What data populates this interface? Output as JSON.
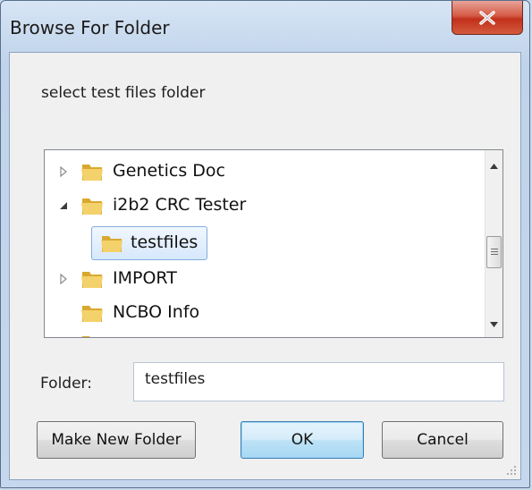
{
  "window": {
    "title": "Browse For Folder",
    "close_icon": "close-icon",
    "accent_close": "#c73b25"
  },
  "prompt": "select test files folder",
  "tree": {
    "items": [
      {
        "label": "Genetics Doc",
        "expander": "collapsed",
        "selected": false
      },
      {
        "label": "i2b2 CRC Tester",
        "expander": "expanded",
        "selected": false
      },
      {
        "label": "testfiles",
        "expander": "none",
        "selected": true
      },
      {
        "label": "IMPORT",
        "expander": "collapsed",
        "selected": false
      },
      {
        "label": "NCBO Info",
        "expander": "none",
        "selected": false
      }
    ],
    "scroll_position": 0.55
  },
  "folder": {
    "label": "Folder:",
    "value": "testfiles"
  },
  "buttons": {
    "make_new_folder": "Make New Folder",
    "ok": "OK",
    "cancel": "Cancel"
  },
  "colors": {
    "folder_yellow": "#e8c14a",
    "selection_border": "#84acdd"
  }
}
